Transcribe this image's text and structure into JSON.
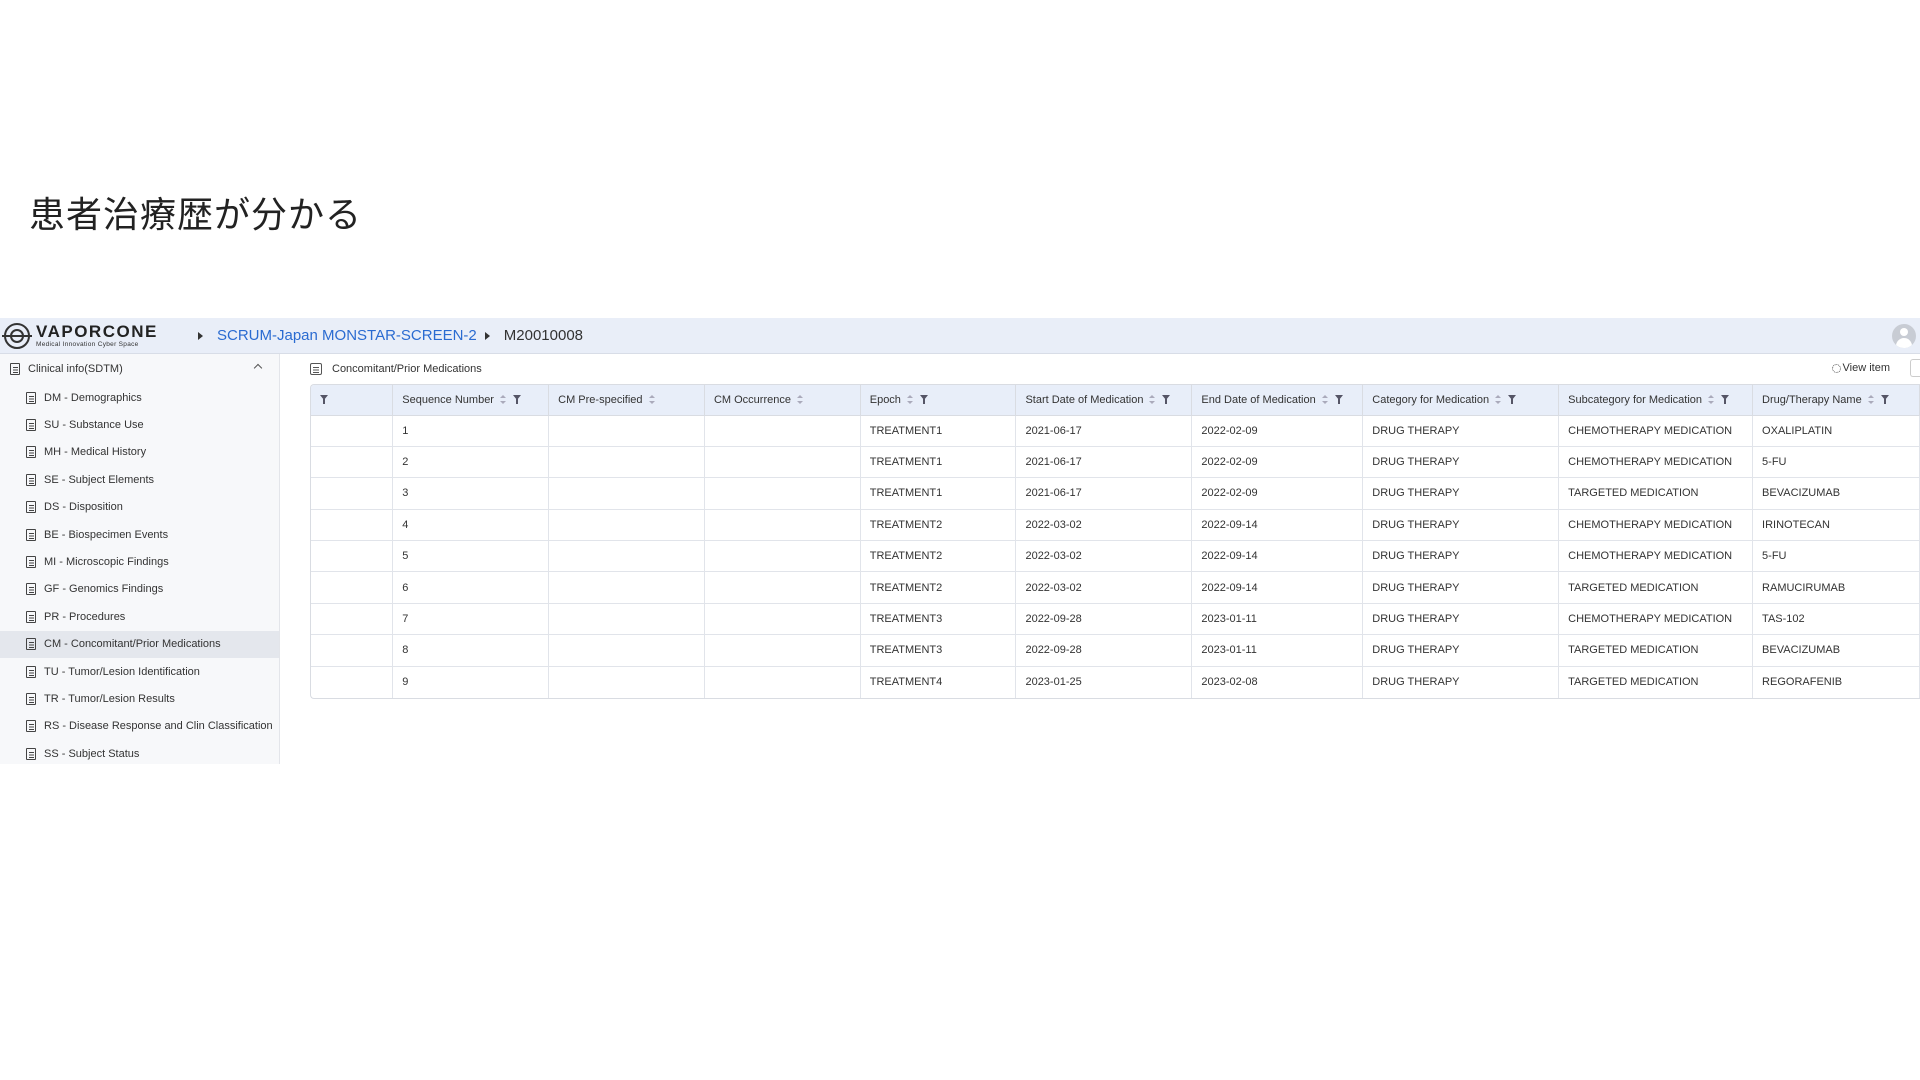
{
  "slide": {
    "title": "患者治療歴が分かる"
  },
  "header": {
    "logo_name": "VAPORCONE",
    "logo_tagline": "Medical Innovation Cyber Space",
    "breadcrumb_project": "SCRUM-Japan MONSTAR-SCREEN-2",
    "breadcrumb_subject": "M20010008"
  },
  "sidebar": {
    "section_label": "Clinical info(SDTM)",
    "items": [
      {
        "label": "DM - Demographics"
      },
      {
        "label": "SU - Substance Use"
      },
      {
        "label": "MH - Medical History"
      },
      {
        "label": "SE - Subject Elements"
      },
      {
        "label": "DS - Disposition"
      },
      {
        "label": "BE - Biospecimen Events"
      },
      {
        "label": "MI - Microscopic Findings"
      },
      {
        "label": "GF - Genomics Findings"
      },
      {
        "label": "PR - Procedures"
      },
      {
        "label": "CM - Concomitant/Prior Medications"
      },
      {
        "label": "TU - Tumor/Lesion Identification"
      },
      {
        "label": "TR - Tumor/Lesion Results"
      },
      {
        "label": "RS - Disease Response and Clin Classification"
      },
      {
        "label": "SS - Subject Status"
      }
    ],
    "active_index": 9
  },
  "main": {
    "panel_title": "Concomitant/Prior Medications",
    "view_item_label": "View item"
  },
  "table": {
    "columns": [
      "Sequence Number",
      "CM Pre-specified",
      "CM Occurrence",
      "Epoch",
      "Start Date of Medication",
      "End Date of Medication",
      "Category for Medication",
      "Subcategory for Medication",
      "Drug/Therapy Name"
    ],
    "rows": [
      [
        "1",
        "",
        "",
        "TREATMENT1",
        "2021-06-17",
        "2022-02-09",
        "DRUG THERAPY",
        "CHEMOTHERAPY MEDICATION",
        "OXALIPLATIN"
      ],
      [
        "2",
        "",
        "",
        "TREATMENT1",
        "2021-06-17",
        "2022-02-09",
        "DRUG THERAPY",
        "CHEMOTHERAPY MEDICATION",
        "5-FU"
      ],
      [
        "3",
        "",
        "",
        "TREATMENT1",
        "2021-06-17",
        "2022-02-09",
        "DRUG THERAPY",
        "TARGETED MEDICATION",
        "BEVACIZUMAB"
      ],
      [
        "4",
        "",
        "",
        "TREATMENT2",
        "2022-03-02",
        "2022-09-14",
        "DRUG THERAPY",
        "CHEMOTHERAPY MEDICATION",
        "IRINOTECAN"
      ],
      [
        "5",
        "",
        "",
        "TREATMENT2",
        "2022-03-02",
        "2022-09-14",
        "DRUG THERAPY",
        "CHEMOTHERAPY MEDICATION",
        "5-FU"
      ],
      [
        "6",
        "",
        "",
        "TREATMENT2",
        "2022-03-02",
        "2022-09-14",
        "DRUG THERAPY",
        "TARGETED MEDICATION",
        "RAMUCIRUMAB"
      ],
      [
        "7",
        "",
        "",
        "TREATMENT3",
        "2022-09-28",
        "2023-01-11",
        "DRUG THERAPY",
        "CHEMOTHERAPY MEDICATION",
        "TAS-102"
      ],
      [
        "8",
        "",
        "",
        "TREATMENT3",
        "2022-09-28",
        "2023-01-11",
        "DRUG THERAPY",
        "TARGETED MEDICATION",
        "BEVACIZUMAB"
      ],
      [
        "9",
        "",
        "",
        "TREATMENT4",
        "2023-01-25",
        "2023-02-08",
        "DRUG THERAPY",
        "TARGETED MEDICATION",
        "REGORAFENIB"
      ]
    ]
  },
  "colors": {
    "header_bg": "#e9eef8",
    "link": "#2a6bd1",
    "table_header_bg": "#e8eef9",
    "sidebar_active_bg": "#e4e7ed"
  }
}
